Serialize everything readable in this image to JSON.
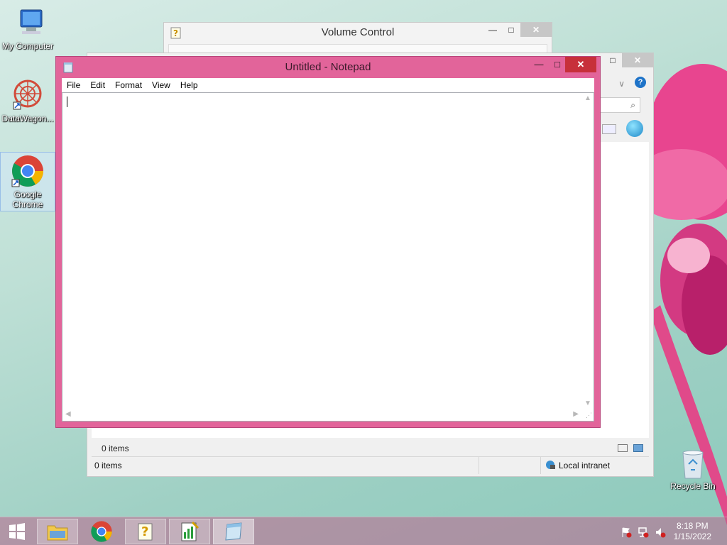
{
  "desktop": {
    "icons": [
      {
        "label": "My Computer",
        "icon": "computer-icon"
      },
      {
        "label": "DataWagon...",
        "icon": "datawagon-icon"
      },
      {
        "label": "Google Chrome",
        "icon": "chrome-icon"
      },
      {
        "label": "Recycle Bin",
        "icon": "recycle-bin-icon"
      }
    ]
  },
  "volume_window": {
    "title": "Volume Control"
  },
  "explorer_window": {
    "items_label": "0 items",
    "status_items": "0 items",
    "status_zone": "Local intranet"
  },
  "notepad": {
    "title": "Untitled - Notepad",
    "menu": [
      "File",
      "Edit",
      "Format",
      "View",
      "Help"
    ],
    "content": ""
  },
  "taskbar": {
    "apps": [
      {
        "name": "File Explorer",
        "icon": "folder-icon"
      },
      {
        "name": "Google Chrome",
        "icon": "chrome-icon"
      },
      {
        "name": "Volume Control",
        "icon": "help-doc-icon"
      },
      {
        "name": "Chart App",
        "icon": "chart-notepad-icon"
      },
      {
        "name": "Notepad",
        "icon": "notepad-icon"
      }
    ],
    "time": "8:18 PM",
    "date": "1/15/2022"
  },
  "colors": {
    "notepad_frame": "#e2649a",
    "close_button": "#c7303a",
    "taskbar": "#be648c"
  }
}
